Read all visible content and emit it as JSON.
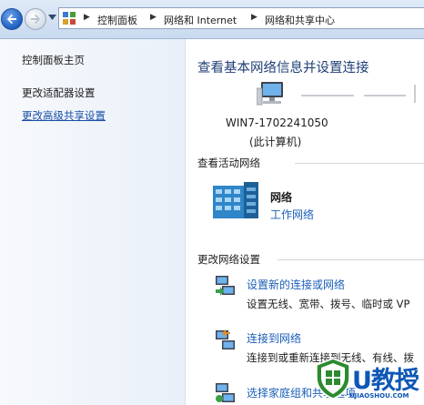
{
  "address_bar": {
    "crumbs": [
      "控制面板",
      "网络和 Internet",
      "网络和共享中心"
    ]
  },
  "left_pane": {
    "links": [
      "控制面板主页",
      "更改适配器设置",
      "更改高级共享设置"
    ]
  },
  "main": {
    "title": "查看基本网络信息并设置连接",
    "computer_name": "WIN7-1702241050",
    "computer_sub": "(此计算机)",
    "active_header": "查看活动网络",
    "network_name": "网络",
    "network_type": "工作网络",
    "change_header": "更改网络设置",
    "tasks": [
      {
        "link": "设置新的连接或网络",
        "desc": "设置无线、宽带、拨号、临时或 VP"
      },
      {
        "link": "连接到网络",
        "desc": "连接到或重新连接到无线、有线、拨"
      },
      {
        "link": "选择家庭组和共享选项",
        "desc": ""
      }
    ]
  },
  "watermark": {
    "text": "U教授",
    "domain": "UJIAOSHOU.COM"
  },
  "colors": {
    "link_blue": "#1b5fb8",
    "title_blue": "#1f3f76",
    "watermark_blue": "#0e57b6"
  }
}
